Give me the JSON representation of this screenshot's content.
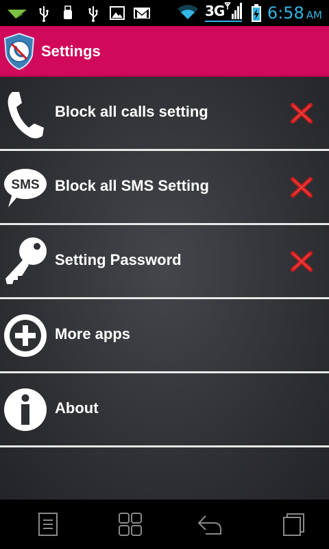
{
  "status_bar": {
    "time": "6:58",
    "ampm": "AM",
    "network": "3G",
    "icons": [
      "app-notification-icon",
      "usb-icon",
      "usb-stick-icon",
      "usb-icon",
      "image-icon",
      "gmail-icon",
      "wifi-icon",
      "signal-icon",
      "battery-charging-icon"
    ]
  },
  "action_bar": {
    "title": "Settings",
    "logo_icon": "shield-blocked-phone-icon",
    "color": "#d1095a"
  },
  "items": [
    {
      "label": "Block all calls setting",
      "icon": "phone-icon",
      "status_icon": "red-x-icon"
    },
    {
      "label": "Block all SMS Setting",
      "icon": "sms-bubble-icon",
      "icon_text": "SMS",
      "status_icon": "red-x-icon"
    },
    {
      "label": "Setting Password",
      "icon": "key-icon",
      "status_icon": "red-x-icon"
    },
    {
      "label": "More apps",
      "icon": "plus-circle-icon"
    },
    {
      "label": "About",
      "icon": "info-icon"
    }
  ],
  "nav_bar": {
    "buttons": [
      "menu-icon",
      "home-grid-icon",
      "back-icon",
      "recent-apps-icon"
    ]
  },
  "colors": {
    "status_accent": "#33b5e5",
    "x_red": "#d01c1c"
  }
}
